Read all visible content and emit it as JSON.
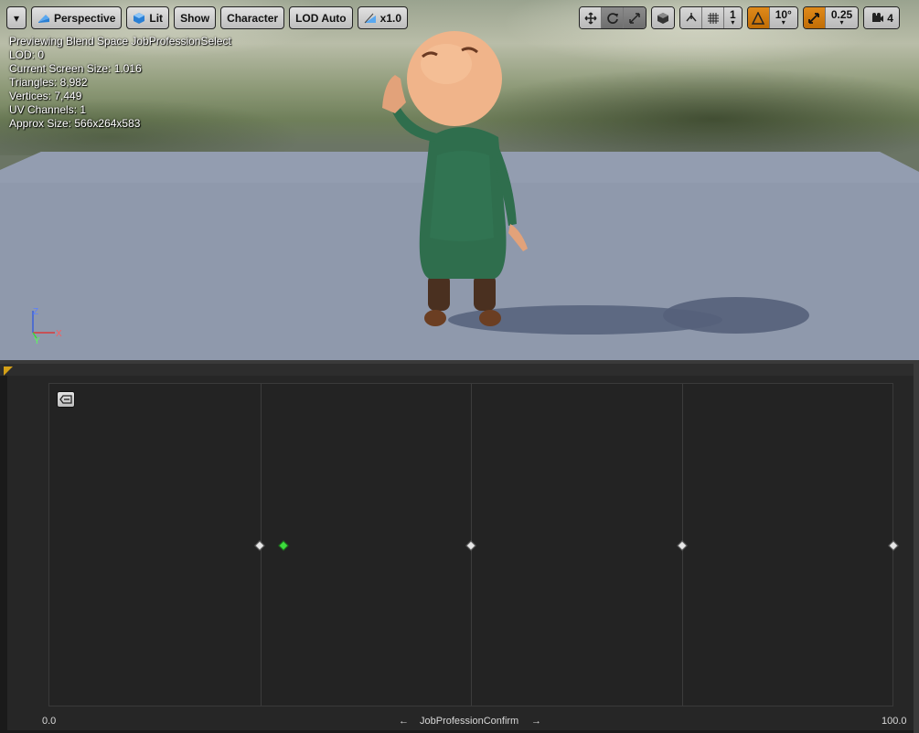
{
  "toolbar": {
    "menu_caret": "▾",
    "perspective_label": "Perspective",
    "lit_label": "Lit",
    "show_label": "Show",
    "character_label": "Character",
    "lod_label": "LOD Auto",
    "speed_label": "x1.0",
    "grid_snap_value": "1",
    "rotation_snap_value": "10°",
    "scale_snap_value": "0.25",
    "camera_speed_value": "4"
  },
  "stats": {
    "line1": "Previewing Blend Space JobProfessionSelect",
    "line2": "LOD: 0",
    "line3": "Current Screen Size: 1.016",
    "line4": "Triangles: 8,982",
    "line5": "Vertices: 7,449",
    "line6": "UV Channels: 1",
    "line7": "Approx Size: 566x264x583"
  },
  "gizmo": {
    "z": "Z",
    "x": "X",
    "y": "Y"
  },
  "blend_space": {
    "axis_min": "0.0",
    "axis_max": "100.0",
    "axis_name": "JobProfessionConfirm",
    "arrow_left": "←",
    "arrow_right": "→",
    "grid_divisions": 4,
    "samples": [
      25,
      50,
      75,
      100
    ],
    "preview_value": 27.8
  },
  "colors": {
    "accent_orange": "#c8740a",
    "sample_active": "#3ddc3d",
    "sample_normal": "#e6e6e6",
    "panel_bg": "#262626"
  }
}
